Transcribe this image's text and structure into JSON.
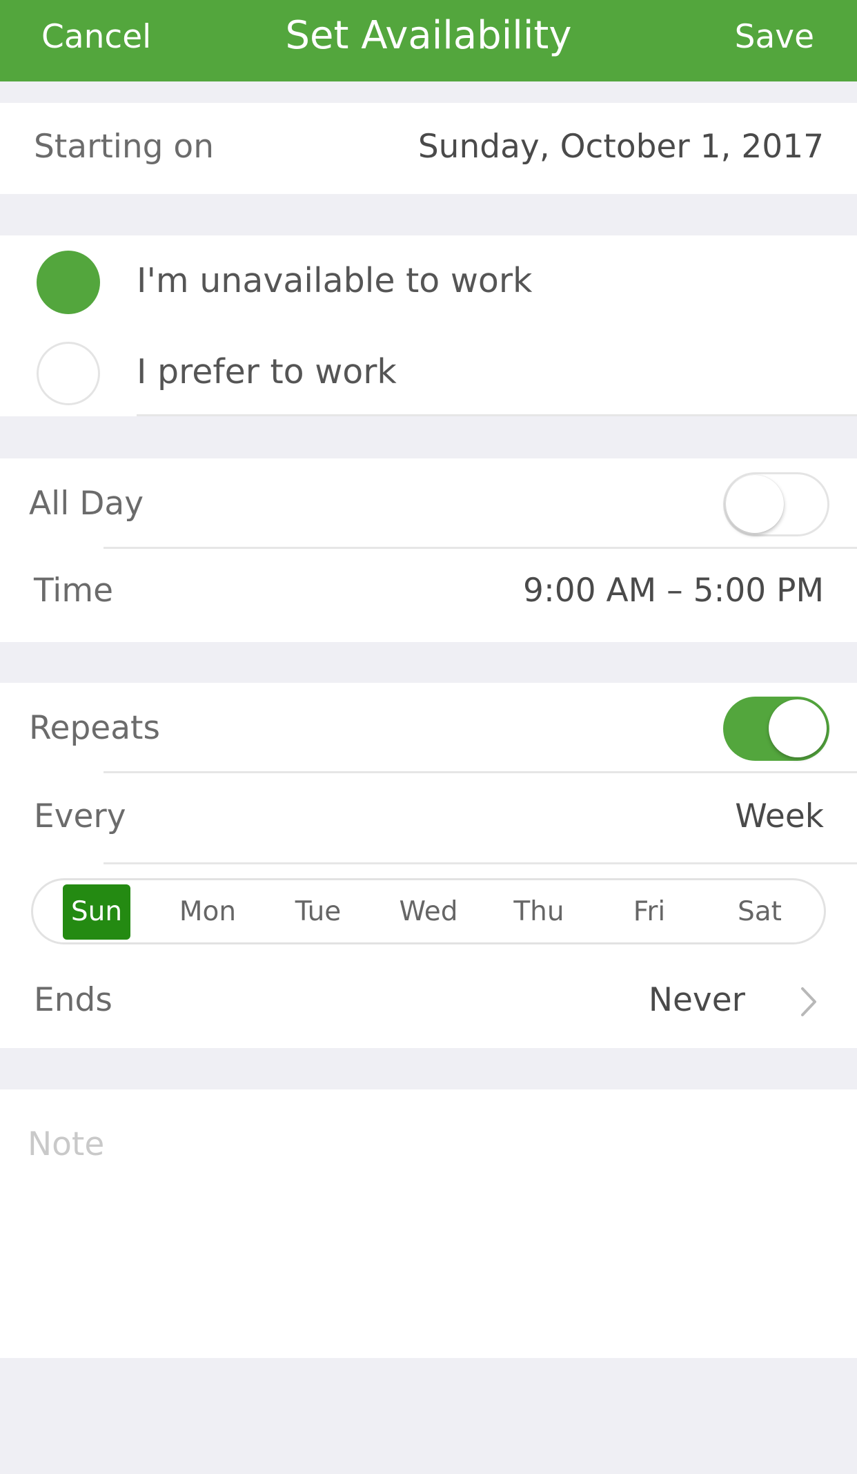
{
  "nav": {
    "cancel": "Cancel",
    "title": "Set Availability",
    "save": "Save"
  },
  "start": {
    "label": "Starting on",
    "value": "Sunday, October 1, 2017"
  },
  "availability": {
    "options": [
      {
        "label": "I'm unavailable to work",
        "selected": true
      },
      {
        "label": "I prefer to work",
        "selected": false
      }
    ]
  },
  "time": {
    "all_day_label": "All Day",
    "all_day_on": false,
    "time_label": "Time",
    "time_value": "9:00 AM – 5:00 PM"
  },
  "repeat": {
    "repeats_label": "Repeats",
    "repeats_on": true,
    "every_label": "Every",
    "every_value": "Week",
    "days": [
      {
        "label": "Sun",
        "selected": true
      },
      {
        "label": "Mon",
        "selected": false
      },
      {
        "label": "Tue",
        "selected": false
      },
      {
        "label": "Wed",
        "selected": false
      },
      {
        "label": "Thu",
        "selected": false
      },
      {
        "label": "Fri",
        "selected": false
      },
      {
        "label": "Sat",
        "selected": false
      }
    ],
    "ends_label": "Ends",
    "ends_value": "Never"
  },
  "note": {
    "placeholder": "Note"
  },
  "colors": {
    "accent": "#53a63d",
    "day_selected": "#248a12",
    "background": "#efeff4"
  }
}
